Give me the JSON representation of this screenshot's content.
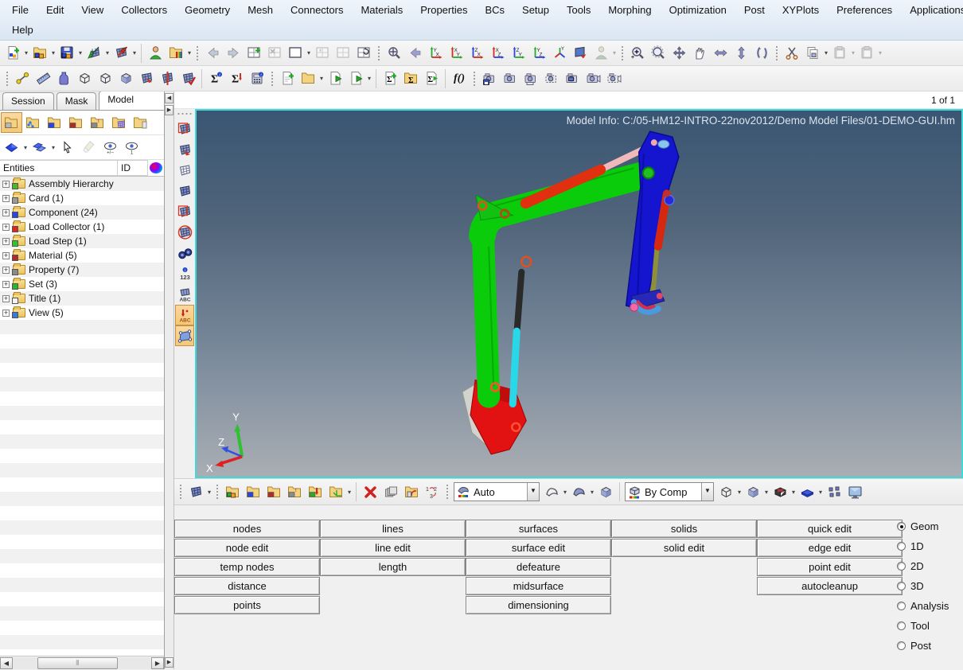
{
  "menu": {
    "items": [
      "File",
      "Edit",
      "View",
      "Collectors",
      "Geometry",
      "Mesh",
      "Connectors",
      "Materials",
      "Properties",
      "BCs",
      "Setup",
      "Tools",
      "Morphing",
      "Optimization",
      "Post",
      "XYPlots",
      "Preferences",
      "Applications",
      "Help"
    ]
  },
  "page_indicator": "1 of 1",
  "tabs": {
    "items": [
      "Session",
      "Mask",
      "Model"
    ]
  },
  "browser": {
    "columns": {
      "entities": "Entities",
      "id": "ID"
    },
    "tree": [
      {
        "label": "Assembly Hierarchy",
        "badge": "#4db526"
      },
      {
        "label": "Card (1)",
        "badge": "#9a9a9a"
      },
      {
        "label": "Component (24)",
        "badge": "#2a46e0"
      },
      {
        "label": "Load Collector (1)",
        "badge": "#e02424"
      },
      {
        "label": "Load Step (1)",
        "badge": "#2dc42d"
      },
      {
        "label": "Material (5)",
        "badge": "#b22a2a"
      },
      {
        "label": "Property (7)",
        "badge": "#8a8a8a"
      },
      {
        "label": "Set (3)",
        "badge": "#2db52d"
      },
      {
        "label": "Title (1)",
        "badge": "#f2f2f2"
      },
      {
        "label": "View (5)",
        "badge": "#3a7ad8"
      }
    ]
  },
  "viewport": {
    "model_info": "Model Info: C:/05-HM12-INTRO-22nov2012/Demo Model Files/01-DEMO-GUI.hm",
    "triad": {
      "x": "X",
      "y": "Y",
      "z": "Z"
    },
    "colors": {
      "bg_top": "#3a5673",
      "bg_bottom": "#a9aeb4",
      "border": "#3fd9dc",
      "boom_green": "#0acc0a",
      "arm_blue": "#1515cf",
      "bucket_red": "#e21212",
      "bucket_side_gray": "#d2d2ce",
      "cylinder_top_red": "#e03010",
      "rod_pink": "#efb9b9",
      "rod_black": "#2a2a2a",
      "cylinder_mid_cyan": "#28d8e8",
      "cylinder_right_red": "#d62810",
      "rod_olive": "#8f8f38",
      "link_light_blue": "#4a9ae0"
    }
  },
  "display_bar": {
    "element_color_mode": "Auto",
    "geometry_color_mode": "By Comp"
  },
  "panel": {
    "buttons": {
      "col1": [
        "nodes",
        "node edit",
        "temp nodes",
        "distance",
        "points"
      ],
      "col2": [
        "lines",
        "line edit",
        "length"
      ],
      "col3": [
        "surfaces",
        "surface edit",
        "defeature",
        "midsurface",
        "dimensioning"
      ],
      "col4": [
        "solids",
        "solid edit"
      ],
      "col5": [
        "quick edit",
        "edge edit",
        "point edit",
        "autocleanup"
      ]
    },
    "pages": [
      {
        "label": "Geom",
        "selected": true
      },
      {
        "label": "1D",
        "selected": false
      },
      {
        "label": "2D",
        "selected": false
      },
      {
        "label": "3D",
        "selected": false
      },
      {
        "label": "Analysis",
        "selected": false
      },
      {
        "label": "Tool",
        "selected": false
      },
      {
        "label": "Post",
        "selected": false
      }
    ]
  },
  "toolbars": {
    "standard": [
      "new-model",
      "open-model",
      "save-model",
      "import",
      "export",
      "user-profile",
      "open-recent",
      "nav-back",
      "nav-forward",
      "new-window",
      "delete-window",
      "blank-window",
      "fill-window",
      "split-window",
      "refresh-window",
      "fit-view",
      "previous-view",
      "view-top",
      "view-bottom",
      "view-left",
      "view-right",
      "view-front",
      "view-rear",
      "view-iso",
      "flip-view",
      "user-view",
      "zoom-in",
      "zoom-lasso",
      "translate-view",
      "pan-view",
      "arrows-horizontal",
      "arrows-vertical",
      "rotate-view",
      "cut",
      "copy",
      "paste",
      "paste-special"
    ],
    "tools": [
      "distance",
      "ruler",
      "mass-calc",
      "wireframe-mode",
      "hidden-line-mode",
      "shaded-mode",
      "mesh-orient",
      "mesh-section",
      "mesh-check",
      "summary-info",
      "summary-export",
      "calculator",
      "new-report",
      "open-report",
      "run-report",
      "run-report-options",
      "new-summary",
      "open-summary",
      "run-summary",
      "function-builder",
      "snapshot-save",
      "snapshot",
      "snapshot-strip",
      "snapshot-region",
      "snapshot-window",
      "video-capture",
      "video-region"
    ],
    "browser_toolbar": [
      "model-view",
      "link-view",
      "component-view",
      "material-view",
      "property-view",
      "mesh-view",
      "partial-view",
      "entity-selector",
      "surface-selector",
      "pointer",
      "highlight",
      "show-hide",
      "isolate"
    ],
    "visibility_toolbar": [
      "geometry-select",
      "geometry-shaded-mesh",
      "mesh-wireframe",
      "mesh-shaded",
      "mesh-mixed",
      "display-none",
      "find-entities",
      "numbers-display",
      "labels-display",
      "arrow-labels-toggle",
      "surface-handles-toggle"
    ],
    "display_toolbar": [
      "mesh-style",
      "assembly-collector",
      "component-collector",
      "material-collector",
      "property-collector",
      "load-collector",
      "system-collector",
      "delete",
      "organize",
      "card-edit",
      "renumber",
      "wireframe-surface",
      "shaded-surface",
      "shaded-cube",
      "wireframe-cube",
      "solid-cube",
      "element-handles",
      "plate-thickness",
      "multi-windows",
      "performance-graphics"
    ]
  }
}
